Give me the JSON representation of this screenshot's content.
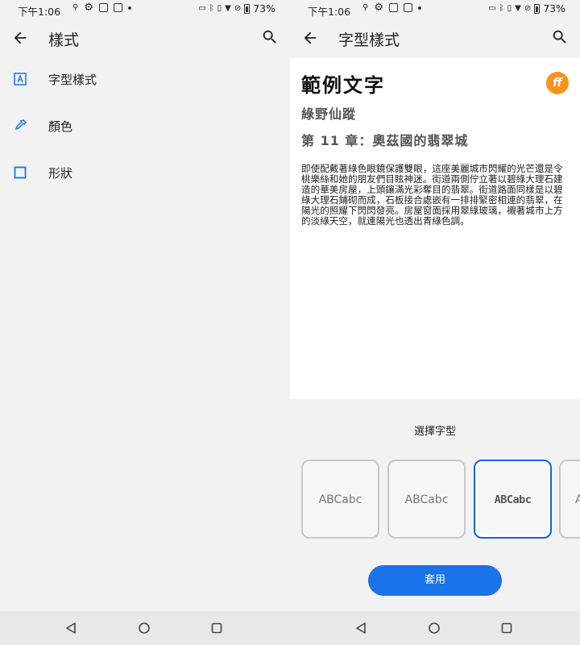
{
  "status_bar": {
    "time": "下午1:06",
    "battery": "73%"
  },
  "left_screen": {
    "title": "樣式",
    "menu": [
      {
        "label": "字型樣式",
        "icon": "font-style-icon"
      },
      {
        "label": "顏色",
        "icon": "color-dropper-icon"
      },
      {
        "label": "形狀",
        "icon": "shape-square-icon"
      }
    ]
  },
  "right_screen": {
    "title": "字型樣式",
    "preview": {
      "heading": "範例文字",
      "subheading": "綠野仙蹤",
      "chapter": "第 11 章：奧茲國的翡翠城",
      "badge": "ff",
      "body": "即使配戴著綠色眼鏡保護雙眼，這座美麗城市閃耀的光芒還是令桃樂絲和她的朋友們目眩神迷。街道兩側佇立著以碧綠大理石建造的華美房屋，上頭鑲滿光彩奪目的翡翠。街道路面同樣是以碧綠大理石鋪砌而成，石板接合處嵌有一排排緊密相連的翡翠，在陽光的照耀下閃閃發亮。房屋窗面採用翠綠玻璃，襯著城市上方的淡綠天空，就連陽光也透出青綠色調。"
    },
    "choose_label": "選擇字型",
    "font_options": [
      "ABCabc",
      "ABCabc",
      "ABCabc",
      "A"
    ],
    "selected_font_index": 2,
    "apply_label": "套用"
  },
  "colors": {
    "accent": "#1a73e8",
    "selected_border": "#1565d8",
    "background": "#f2f2f2",
    "badge": "#f7941d"
  }
}
